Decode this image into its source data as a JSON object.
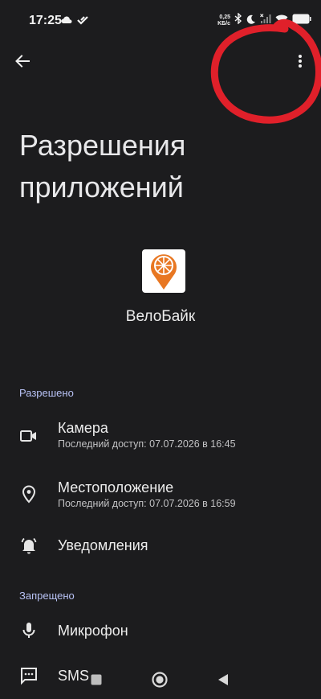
{
  "status_bar": {
    "time": "17:25",
    "net_speed_value": "0,25",
    "net_speed_unit": "KБ/c"
  },
  "header": {
    "title": "Разрешения приложений"
  },
  "app": {
    "name": "ВелоБайк",
    "icon": "velobike-logo",
    "brand_color": "#e87722"
  },
  "allowed": {
    "header": "Разрешено",
    "items": [
      {
        "title": "Камера",
        "subtitle": "Последний доступ: 07.07.2026 в 16:45",
        "icon": "camera-icon"
      },
      {
        "title": "Местоположение",
        "subtitle": "Последний доступ: 07.07.2026 в 16:59",
        "icon": "location-icon"
      },
      {
        "title": "Уведомления",
        "icon": "notification-bell-icon"
      }
    ]
  },
  "denied": {
    "header": "Запрещено",
    "items": [
      {
        "title": "Микрофон",
        "icon": "microphone-icon"
      },
      {
        "title": "SMS",
        "icon": "sms-icon"
      }
    ]
  },
  "colors": {
    "background": "#1c1c1e",
    "section_header": "#b8c2f5",
    "annotation": "#e0202a"
  }
}
